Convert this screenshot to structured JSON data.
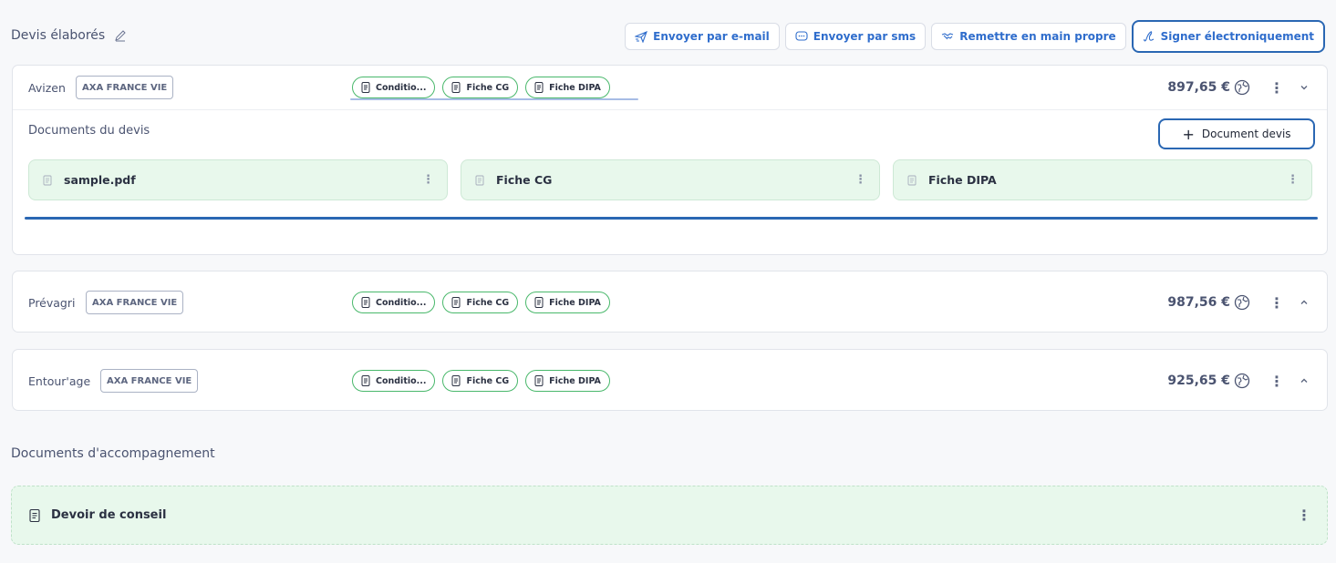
{
  "header": {
    "title": "Devis élaborés"
  },
  "actions": [
    {
      "label": "Envoyer par e-mail",
      "icon": "send-icon"
    },
    {
      "label": "Envoyer par sms",
      "icon": "chat-icon"
    },
    {
      "label": "Remettre en main propre",
      "icon": "handshake-icon"
    },
    {
      "label": "Signer électroniquement",
      "icon": "signature-icon"
    }
  ],
  "quotes": [
    {
      "name": "Avizen",
      "insurer": "AXA FRANCE VIE",
      "docs": [
        "Conditio...",
        "Fiche CG",
        "Fiche DIPA"
      ],
      "price": "897,65 €",
      "expanded": true,
      "documents_title": "Documents du devis",
      "add_label": "Document devis",
      "files": [
        "sample.pdf",
        "Fiche CG",
        "Fiche DIPA"
      ]
    },
    {
      "name": "Prévagri",
      "insurer": "AXA FRANCE VIE",
      "docs": [
        "Conditio...",
        "Fiche CG",
        "Fiche DIPA"
      ],
      "price": "987,56 €",
      "expanded": false
    },
    {
      "name": "Entour'age",
      "insurer": "AXA FRANCE VIE",
      "docs": [
        "Conditio...",
        "Fiche CG",
        "Fiche DIPA"
      ],
      "price": "925,65 €",
      "expanded": false
    }
  ],
  "accompaniment": {
    "title": "Documents d'accompagnement",
    "items": [
      "Devoir de conseil"
    ]
  },
  "colors": {
    "accent": "#2f6dcc",
    "highlight": "#2a67b3",
    "doc_green": "#49b86b",
    "file_bg": "#e8f8ec"
  }
}
